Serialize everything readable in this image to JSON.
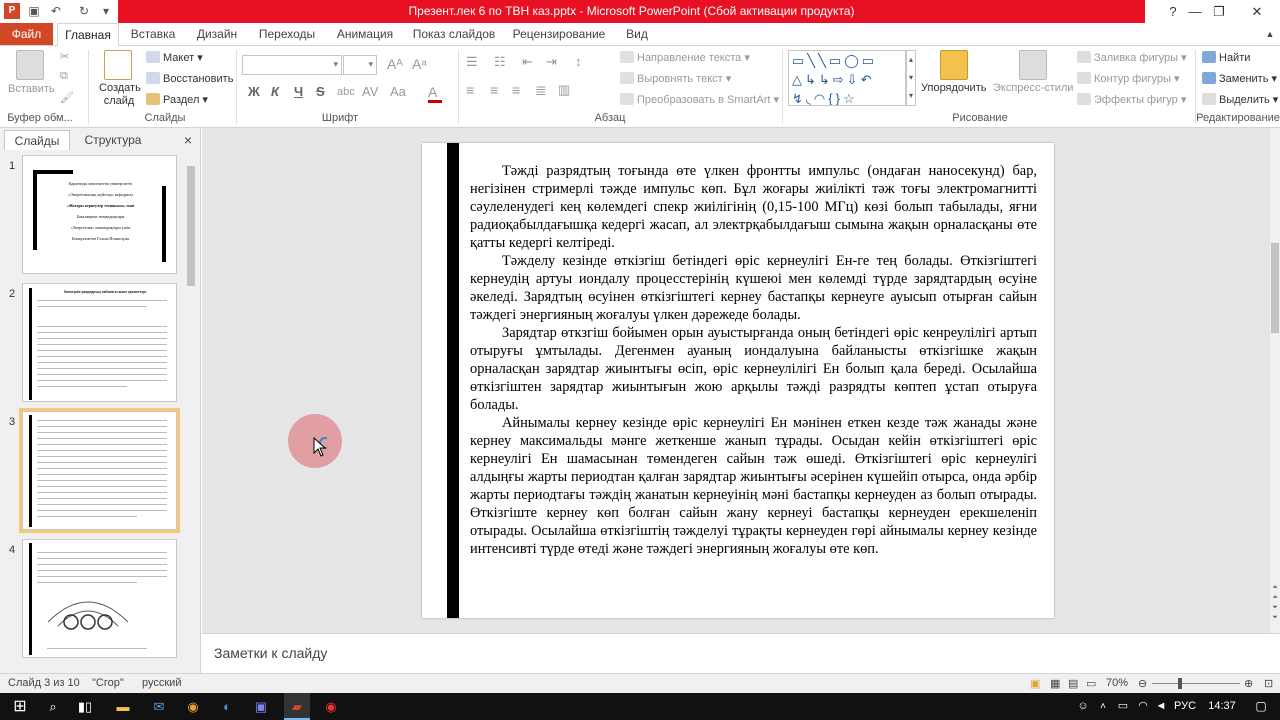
{
  "window": {
    "title": "Презент.лек 6 по ТВН каз.pptx  -  Microsoft PowerPoint (Сбой активации продукта)"
  },
  "tabs": {
    "file": "Файл",
    "items": [
      "Главная",
      "Вставка",
      "Дизайн",
      "Переходы",
      "Анимация",
      "Показ слайдов",
      "Рецензирование",
      "Вид"
    ]
  },
  "ribbon": {
    "clipboard": {
      "paste": "Вставить",
      "group": "Буфер обм..."
    },
    "slides": {
      "new_slide": "Создать слайд",
      "layout": "Макет",
      "reset": "Восстановить",
      "section": "Раздел",
      "group": "Слайды"
    },
    "font": {
      "bold": "Ж",
      "italic": "К",
      "underline": "Ч",
      "strike": "S",
      "group": "Шрифт"
    },
    "paragraph": {
      "text_direction": "Направление текста",
      "align_text": "Выровнять текст",
      "smartart": "Преобразовать в SmartArt",
      "group": "Абзац"
    },
    "drawing": {
      "arrange": "Упорядочить",
      "quick_styles": "Экспресс-стили",
      "fill": "Заливка фигуры",
      "outline": "Контур фигуры",
      "effects": "Эффекты фигур",
      "group": "Рисование",
      "shapes_glyphs": "▭╲╲▭◯▭ △↳↳⇨⇩↶ ↯◟◠{}☆"
    },
    "editing": {
      "find": "Найти",
      "replace": "Заменить",
      "select": "Выделить",
      "group": "Редактирование"
    }
  },
  "pane": {
    "tab_slides": "Слайды",
    "tab_outline": "Структура",
    "close": "×"
  },
  "thumbnails": [
    {
      "number": "1",
      "lines": [
        "Қарағанды мемлекеттік университеті",
        "«Энергетикалық жүйелер» кафедрасы",
        "«Жоғары кернеулер техникасы»   пәні",
        "Бакалавриат мамандықтары",
        "«Энергетика» мамандықтары үшін",
        "Бекмұхаметов Ғалым Исмаилұлы"
      ]
    },
    {
      "number": "2",
      "heading": "Электрлік разрядтың табиғаты және қасиеттері"
    },
    {
      "number": "3"
    },
    {
      "number": "4"
    }
  ],
  "slide": {
    "paragraphs": [
      "Тәжді разрядтың тоғында өте үлкен фронтты импульс (ондаған наносекунд) бар, негізінен стримерлі тәжде импульс көп. Бұл жоғары жиілікті тәж тоғы электромагнитті сәулеленудегі кең көлемдегі спекр жиілігінің (0,15-100 МГц) көзі болып табылады, яғни радиоқабылдағышқа кедергі жасап, ал электрқабылдағыш сымына жақын орналасқаны өте қатты кедергі келтіреді.",
      "Тәжделу кезінде өткізгіш бетіндегі өріс кернеулігі Ен-ге тең болады. Өткізгіштегі кернеудің артуы иондалу процесстерінің күшеюі мен көлемді түрде зарядтардың өсуіне әкеледі. Зарядтың өсуінен өткізгіштегі кернеу бастапқы кернеуге ауысып отырған сайын тәждегі энергияның жоғалуы үлкен дәрежеде болады.",
      "Зарядтар өткзгіш бойымен орын ауыстырғанда оның бетіндегі өріс кенреулілігі артып отыруғы ұмтылады. Дегенмен ауаның иондалуына байланысты өткізгішке жақын орналасқан зарядтар жиынтығы өсіп, өріс кернеулілігі Ен болып қала береді. Осылайша өткізгіштен зарядтар жиынтығын жою арқылы тәжді разрядты көптеп ұстап отыруға болады.",
      "Айнымалы кернеу кезінде өріс кернеулігі Ен мәнінен еткен кезде тәж жанады және кернеу максимальды мәнге жеткенше жанып тұрады. Осыдан кейін өткізгіштегі өріс кернеулігі Ен шамасынан төмендеген сайын тәж өшеді. Өткізгіштегі өріс кернеулігі алдыңғы жарты периодтан қалған зарядтар жиынтығы әсерінен күшейіп отырса, онда әрбір жарты периодтағы тәждің жанатын кернеуінің мәні бастапқы кернеуден аз болып отырады. Өткізгіште кернеу көп болған сайын жану кернеуі бастапқы кернеуден ерекшеленіп отырады. Осылайша өткізгіштің тәжделуі тұрақты кернеуден гөрі айнымалы кернеу кезінде интенсивті түрде өтеді және тәждегі энергияның жоғалуы өте көп."
    ]
  },
  "notes": {
    "placeholder": "Заметки к слайду"
  },
  "status": {
    "slide_info": "Слайд 3 из 10",
    "theme": "\"Сгор\"",
    "language": "русский",
    "zoom": "70%"
  },
  "taskbar": {
    "lang": "РУС",
    "time": "14:37"
  },
  "colors": {
    "accent": "#d24726",
    "titlebar": "#e81123",
    "taskbar": "#111111"
  }
}
